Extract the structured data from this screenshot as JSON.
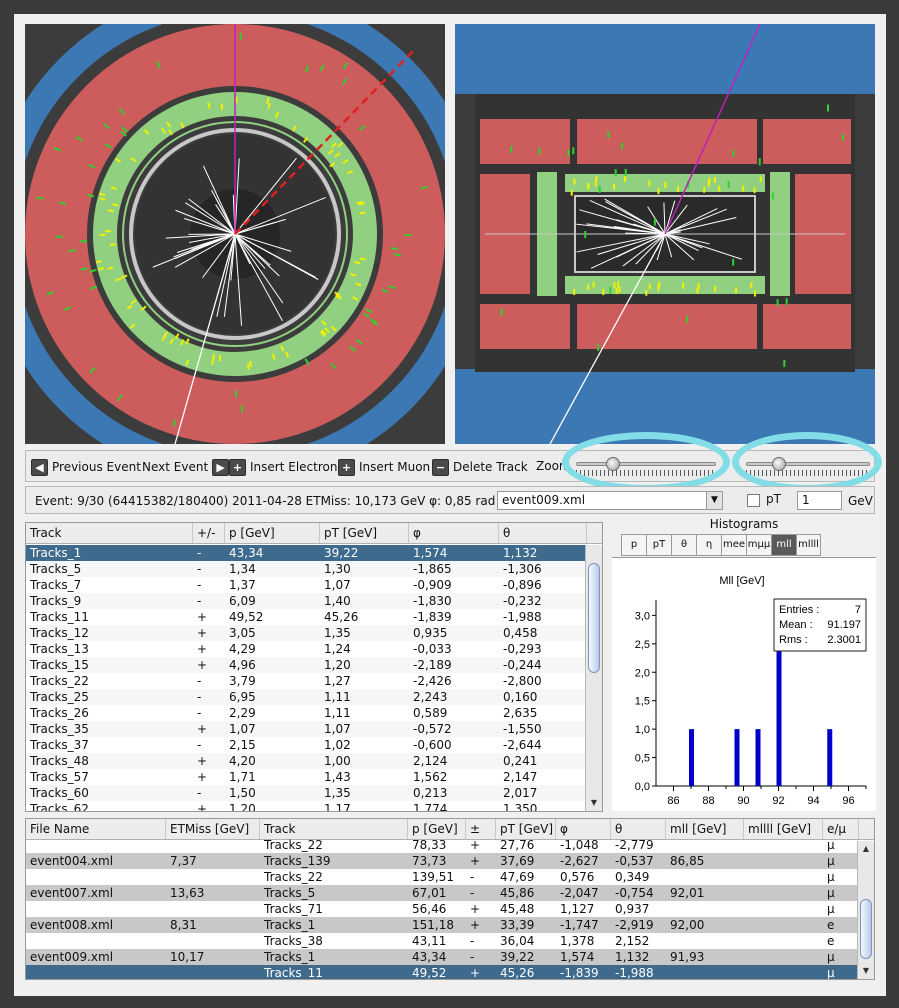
{
  "toolbar": {
    "prev_label": "Previous Event",
    "next_label": "Next Event",
    "insert_electron_label": "Insert Electron",
    "insert_muon_label": "Insert Muon",
    "delete_track_label": "Delete Track",
    "zoom_label": "Zoom",
    "icons": {
      "prev": "arrow-left-icon",
      "next": "arrow-right-icon",
      "electron": "plus-icon",
      "muon": "plus-icon",
      "delete": "minus-icon"
    },
    "zoom_value": 0.24,
    "zoom2_value": 0.24
  },
  "event_info": {
    "text": "Event: 9/30 (64415382/180400)  2011-04-28   ETMiss: 10,173 GeV   φ: 0,85 rad",
    "file_select": "event009.xml",
    "pt_label": "pT",
    "pt_value": "1",
    "pt_unit": "GeV"
  },
  "tracks_table": {
    "headers": [
      "Track",
      "+/-",
      "p [GeV]",
      "pT [GeV]",
      "φ",
      "θ"
    ],
    "rows": [
      [
        "Tracks_1",
        "-",
        "43,34",
        "39,22",
        "1,574",
        "1,132"
      ],
      [
        "Tracks_5",
        "-",
        "1,34",
        "1,30",
        "-1,865",
        "-1,306"
      ],
      [
        "Tracks_7",
        "-",
        "1,37",
        "1,07",
        "-0,909",
        "-0,896"
      ],
      [
        "Tracks_9",
        "-",
        "6,09",
        "1,40",
        "-1,830",
        "-0,232"
      ],
      [
        "Tracks_11",
        "+",
        "49,52",
        "45,26",
        "-1,839",
        "-1,988"
      ],
      [
        "Tracks_12",
        "+",
        "3,05",
        "1,35",
        "0,935",
        "0,458"
      ],
      [
        "Tracks_13",
        "+",
        "4,29",
        "1,24",
        "-0,033",
        "-0,293"
      ],
      [
        "Tracks_15",
        "+",
        "4,96",
        "1,20",
        "-2,189",
        "-0,244"
      ],
      [
        "Tracks_22",
        "-",
        "3,79",
        "1,27",
        "-2,426",
        "-2,800"
      ],
      [
        "Tracks_25",
        "-",
        "6,95",
        "1,11",
        "2,243",
        "0,160"
      ],
      [
        "Tracks_26",
        "-",
        "2,29",
        "1,11",
        "0,589",
        "2,635"
      ],
      [
        "Tracks_35",
        "+",
        "1,07",
        "1,07",
        "-0,572",
        "-1,550"
      ],
      [
        "Tracks_37",
        "-",
        "2,15",
        "1,02",
        "-0,600",
        "-2,644"
      ],
      [
        "Tracks_48",
        "+",
        "4,20",
        "1,00",
        "2,124",
        "0,241"
      ],
      [
        "Tracks_57",
        "+",
        "1,71",
        "1,43",
        "1,562",
        "2,147"
      ],
      [
        "Tracks_60",
        "-",
        "1,50",
        "1,35",
        "0,213",
        "2,017"
      ],
      [
        "Tracks_62",
        "+",
        "1,20",
        "1,17",
        "1,774",
        "1,350"
      ]
    ],
    "selected_index": 0
  },
  "histograms": {
    "title": "Histograms",
    "tabs": [
      "p",
      "pT",
      "θ",
      "η",
      "mee",
      "mμμ",
      "mll",
      "mllll"
    ],
    "active_tab": 6,
    "plot_title": "Mll [GeV]",
    "stats": {
      "entries_label": "Entries :",
      "entries": "7",
      "mean_label": "Mean :",
      "mean": "91.197",
      "rms_label": "Rms :",
      "rms": "2.3001"
    }
  },
  "chart_data": {
    "type": "bar",
    "title": "Mll [GeV]",
    "xlabel": "",
    "ylabel": "",
    "xlim": [
      85,
      97
    ],
    "ylim": [
      0,
      3.2
    ],
    "xticks": [
      "86",
      "88",
      "90",
      "92",
      "94",
      "96"
    ],
    "yticks": [
      "0,0",
      "0,5",
      "1,0",
      "1,5",
      "2,0",
      "2,5",
      "3,0"
    ],
    "x": [
      87.0,
      89.6,
      90.8,
      92.0,
      94.9
    ],
    "values": [
      1,
      1,
      1,
      3,
      1
    ],
    "bar_color": "#0000c8"
  },
  "files_table": {
    "headers": [
      "File Name",
      "ETMiss [GeV]",
      "Track",
      "p [GeV]",
      "±",
      "pT [GeV]",
      "φ",
      "θ",
      "mll [GeV]",
      "mllll [GeV]",
      "e/μ"
    ],
    "rows": [
      {
        "file": "",
        "etmiss": "",
        "track": "Tracks_22",
        "p": "78,33",
        "q": "+",
        "pt": "27,76",
        "phi": "-1,048",
        "theta": "-2,779",
        "mll": "",
        "mllll": "",
        "type": "μ",
        "style": "plain"
      },
      {
        "file": "event004.xml",
        "etmiss": "7,37",
        "track": "Tracks_139",
        "p": "73,73",
        "q": "+",
        "pt": "37,69",
        "phi": "-2,627",
        "theta": "-0,537",
        "mll": "86,85",
        "mllll": "",
        "type": "μ",
        "style": "grey"
      },
      {
        "file": "",
        "etmiss": "",
        "track": "Tracks_22",
        "p": "139,51",
        "q": "-",
        "pt": "47,69",
        "phi": "0,576",
        "theta": "0,349",
        "mll": "",
        "mllll": "",
        "type": "μ",
        "style": "plain"
      },
      {
        "file": "event007.xml",
        "etmiss": "13,63",
        "track": "Tracks_5",
        "p": "67,01",
        "q": "-",
        "pt": "45,86",
        "phi": "-2,047",
        "theta": "-0,754",
        "mll": "92,01",
        "mllll": "",
        "type": "μ",
        "style": "grey"
      },
      {
        "file": "",
        "etmiss": "",
        "track": "Tracks_71",
        "p": "56,46",
        "q": "+",
        "pt": "45,48",
        "phi": "1,127",
        "theta": "0,937",
        "mll": "",
        "mllll": "",
        "type": "μ",
        "style": "plain"
      },
      {
        "file": "event008.xml",
        "etmiss": "8,31",
        "track": "Tracks_1",
        "p": "151,18",
        "q": "+",
        "pt": "33,39",
        "phi": "-1,747",
        "theta": "-2,919",
        "mll": "92,00",
        "mllll": "",
        "type": "e",
        "style": "grey"
      },
      {
        "file": "",
        "etmiss": "",
        "track": "Tracks_38",
        "p": "43,11",
        "q": "-",
        "pt": "36,04",
        "phi": "1,378",
        "theta": "2,152",
        "mll": "",
        "mllll": "",
        "type": "e",
        "style": "plain"
      },
      {
        "file": "event009.xml",
        "etmiss": "10,17",
        "track": "Tracks_1",
        "p": "43,34",
        "q": "-",
        "pt": "39,22",
        "phi": "1,574",
        "theta": "1,132",
        "mll": "91,93",
        "mllll": "",
        "type": "μ",
        "style": "grey"
      },
      {
        "file": "",
        "etmiss": "",
        "track": "Tracks_11",
        "p": "49,52",
        "q": "+",
        "pt": "45,26",
        "phi": "-1,839",
        "theta": "-1,988",
        "mll": "",
        "mllll": "",
        "type": "μ",
        "style": "sel"
      }
    ]
  },
  "colors": {
    "calorimeter_hadronic": "#cd5c5c",
    "calorimeter_em": "#90d080",
    "muon_chamber": "#3c78b4",
    "selection": "#3e6a8e",
    "highlight": "#82dde6",
    "hits_yellow": "#f0f000",
    "hits_green": "#30d030",
    "track_magenta": "#c020c0",
    "track_red": "#e02020"
  }
}
